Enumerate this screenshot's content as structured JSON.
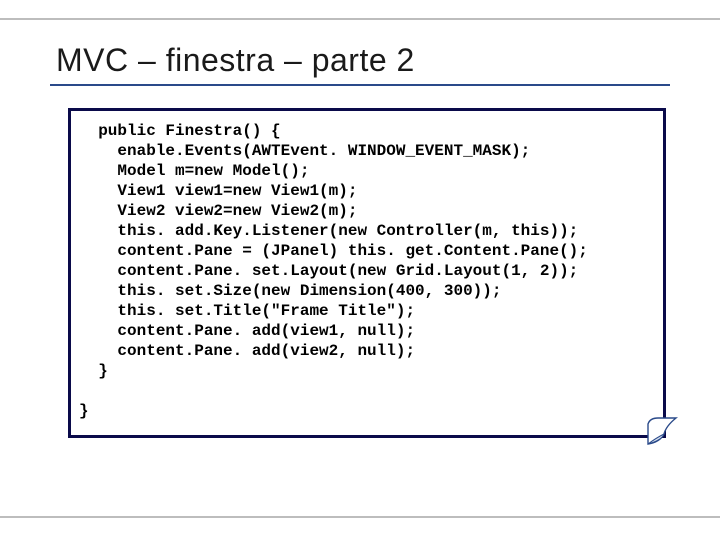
{
  "title": "MVC –  finestra – parte 2",
  "code": "  public Finestra() {\n    enable.Events(AWTEvent. WINDOW_EVENT_MASK);\n    Model m=new Model();\n    View1 view1=new View1(m);\n    View2 view2=new View2(m);\n    this. add.Key.Listener(new Controller(m, this));\n    content.Pane = (JPanel) this. get.Content.Pane();\n    content.Pane. set.Layout(new Grid.Layout(1, 2));\n    this. set.Size(new Dimension(400, 300));\n    this. set.Title(\"Frame Title\");\n    content.Pane. add(view1, null);\n    content.Pane. add(view2, null);\n  }\n\n}"
}
